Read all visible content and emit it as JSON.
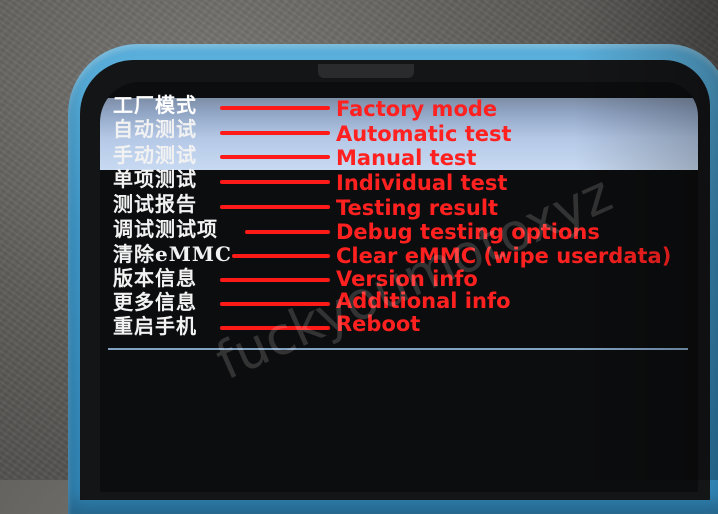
{
  "menu": {
    "items": [
      {
        "label": "工厂模式",
        "annotation": "Factory mode"
      },
      {
        "label": "自动测试",
        "annotation": "Automatic test"
      },
      {
        "label": "手动测试",
        "annotation": "Manual test"
      },
      {
        "label": "单项测试",
        "annotation": "Individual test"
      },
      {
        "label": "测试报告",
        "annotation": "Testing result"
      },
      {
        "label": "调试测试项",
        "annotation": "Debug testing options"
      },
      {
        "label": "清除eMMC",
        "annotation": "Clear eMMC (wipe userdata)"
      },
      {
        "label": "版本信息",
        "annotation": "Version info"
      },
      {
        "label": "更多信息",
        "annotation": "Additional info"
      },
      {
        "label": "重启手机",
        "annotation": "Reboot"
      }
    ],
    "selected_index": 0
  },
  "watermark": "fuckyoumotoxyz",
  "colors": {
    "annotation": "#ff2020",
    "menu_text": "#f2f2f2",
    "highlight": "#b4c8e6",
    "phone_case": "#3f98c9"
  }
}
